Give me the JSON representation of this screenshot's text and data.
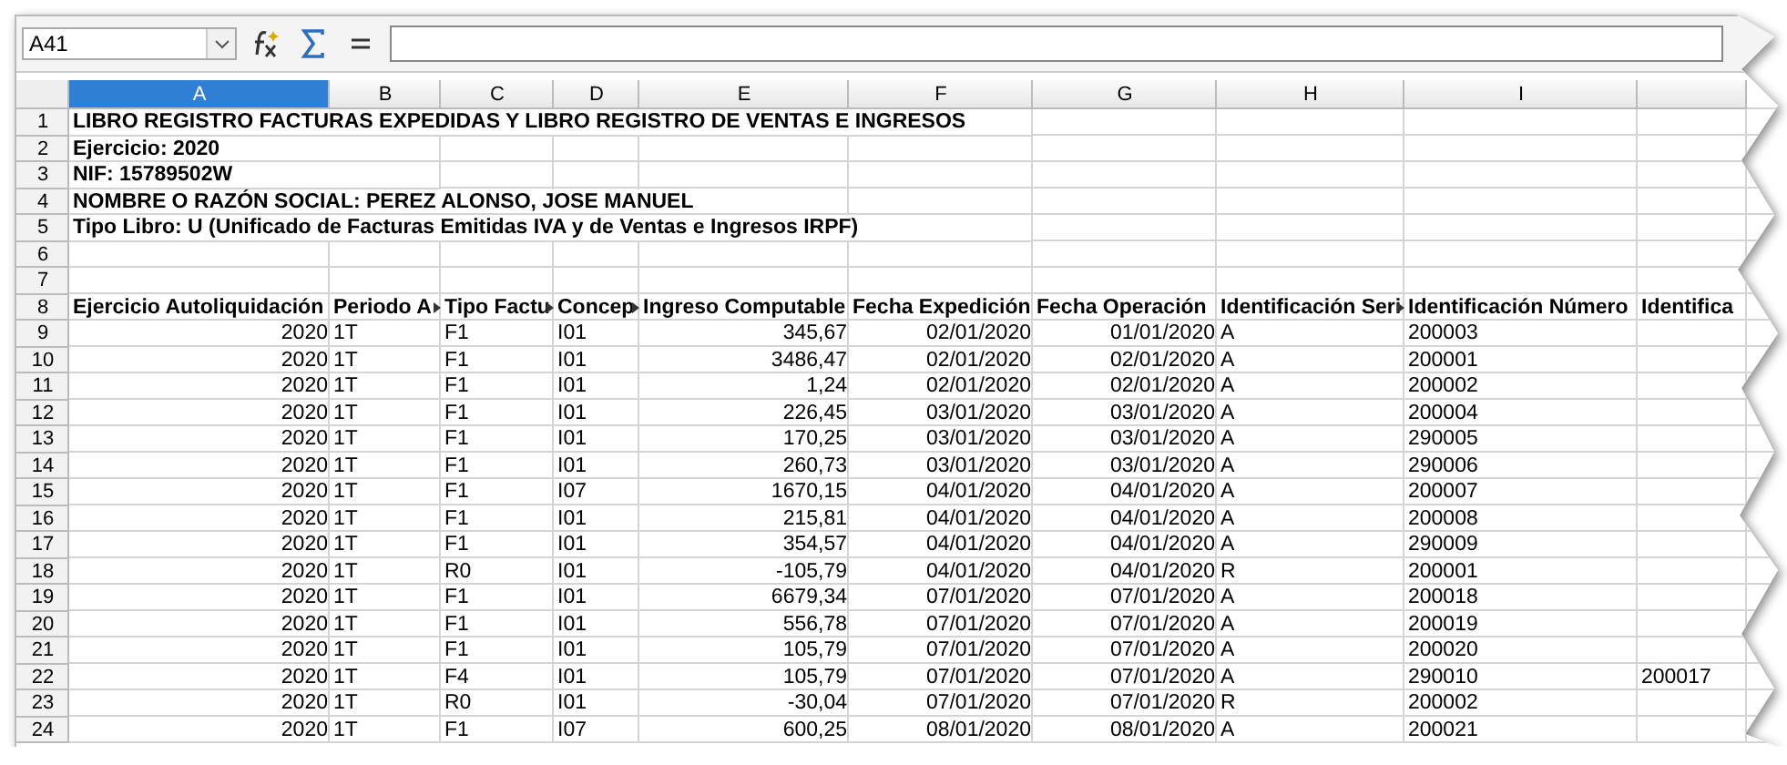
{
  "name_box": {
    "value": "A41"
  },
  "columns": [
    {
      "label": "A",
      "selected": true
    },
    {
      "label": "B",
      "selected": false
    },
    {
      "label": "C",
      "selected": false
    },
    {
      "label": "D",
      "selected": false
    },
    {
      "label": "E",
      "selected": false
    },
    {
      "label": "F",
      "selected": false
    },
    {
      "label": "G",
      "selected": false
    },
    {
      "label": "H",
      "selected": false
    },
    {
      "label": "I",
      "selected": false
    }
  ],
  "rows": [
    {
      "number": "1",
      "kind": "title",
      "text": "LIBRO REGISTRO FACTURAS EXPEDIDAS Y LIBRO REGISTRO DE VENTAS E INGRESOS"
    },
    {
      "number": "2",
      "kind": "title",
      "text": "Ejercicio: 2020"
    },
    {
      "number": "3",
      "kind": "title",
      "text": "NIF: 15789502W"
    },
    {
      "number": "4",
      "kind": "title",
      "text": "NOMBRE O RAZÓN SOCIAL: PEREZ ALONSO, JOSE MANUEL"
    },
    {
      "number": "5",
      "kind": "title",
      "text": "Tipo Libro: U (Unificado de Facturas Emitidas IVA y de Ventas e Ingresos IRPF)"
    },
    {
      "number": "6",
      "kind": "empty"
    },
    {
      "number": "7",
      "kind": "empty"
    },
    {
      "number": "8",
      "kind": "header",
      "cells": [
        {
          "text": "Ejercicio Autoliquidación",
          "truncated": false
        },
        {
          "text": "Periodo A",
          "truncated": true
        },
        {
          "text": "Tipo Factu",
          "truncated": true
        },
        {
          "text": "Concep",
          "truncated": true
        },
        {
          "text": "Ingreso Computable",
          "truncated": false
        },
        {
          "text": "Fecha Expedición",
          "truncated": false
        },
        {
          "text": "Fecha Operación",
          "truncated": false
        },
        {
          "text": "Identificación Seri",
          "truncated": true
        },
        {
          "text": "Identificación Número",
          "truncated": false
        },
        {
          "text": "Identifica",
          "truncated": false
        }
      ]
    },
    {
      "number": "9",
      "kind": "data",
      "cells": [
        "2020",
        "1T",
        "F1",
        "I01",
        "345,67",
        "02/01/2020",
        "01/01/2020",
        "A",
        "200003"
      ]
    },
    {
      "number": "10",
      "kind": "data",
      "cells": [
        "2020",
        "1T",
        "F1",
        "I01",
        "3486,47",
        "02/01/2020",
        "02/01/2020",
        "A",
        "200001"
      ]
    },
    {
      "number": "11",
      "kind": "data",
      "cells": [
        "2020",
        "1T",
        "F1",
        "I01",
        "1,24",
        "02/01/2020",
        "02/01/2020",
        "A",
        "200002"
      ]
    },
    {
      "number": "12",
      "kind": "data",
      "cells": [
        "2020",
        "1T",
        "F1",
        "I01",
        "226,45",
        "03/01/2020",
        "03/01/2020",
        "A",
        "200004"
      ]
    },
    {
      "number": "13",
      "kind": "data",
      "cells": [
        "2020",
        "1T",
        "F1",
        "I01",
        "170,25",
        "03/01/2020",
        "03/01/2020",
        "A",
        "290005"
      ]
    },
    {
      "number": "14",
      "kind": "data",
      "cells": [
        "2020",
        "1T",
        "F1",
        "I01",
        "260,73",
        "03/01/2020",
        "03/01/2020",
        "A",
        "290006"
      ]
    },
    {
      "number": "15",
      "kind": "data",
      "cells": [
        "2020",
        "1T",
        "F1",
        "I07",
        "1670,15",
        "04/01/2020",
        "04/01/2020",
        "A",
        "200007"
      ]
    },
    {
      "number": "16",
      "kind": "data",
      "cells": [
        "2020",
        "1T",
        "F1",
        "I01",
        "215,81",
        "04/01/2020",
        "04/01/2020",
        "A",
        "200008"
      ]
    },
    {
      "number": "17",
      "kind": "data",
      "cells": [
        "2020",
        "1T",
        "F1",
        "I01",
        "354,57",
        "04/01/2020",
        "04/01/2020",
        "A",
        "290009"
      ]
    },
    {
      "number": "18",
      "kind": "data",
      "cells": [
        "2020",
        "1T",
        "R0",
        "I01",
        "-105,79",
        "04/01/2020",
        "04/01/2020",
        "R",
        "200001"
      ]
    },
    {
      "number": "19",
      "kind": "data",
      "cells": [
        "2020",
        "1T",
        "F1",
        "I01",
        "6679,34",
        "07/01/2020",
        "07/01/2020",
        "A",
        "200018"
      ]
    },
    {
      "number": "20",
      "kind": "data",
      "cells": [
        "2020",
        "1T",
        "F1",
        "I01",
        "556,78",
        "07/01/2020",
        "07/01/2020",
        "A",
        "200019"
      ]
    },
    {
      "number": "21",
      "kind": "data",
      "cells": [
        "2020",
        "1T",
        "F1",
        "I01",
        "105,79",
        "07/01/2020",
        "07/01/2020",
        "A",
        "200020"
      ]
    },
    {
      "number": "22",
      "kind": "data",
      "cells": [
        "2020",
        "1T",
        "F4",
        "I01",
        "105,79",
        "07/01/2020",
        "07/01/2020",
        "A",
        "290010",
        "200017"
      ]
    },
    {
      "number": "23",
      "kind": "data",
      "cells": [
        "2020",
        "1T",
        "R0",
        "I01",
        "-30,04",
        "07/01/2020",
        "07/01/2020",
        "R",
        "200002"
      ]
    },
    {
      "number": "24",
      "kind": "data",
      "cells": [
        "2020",
        "1T",
        "F1",
        "I07",
        "600,25",
        "08/01/2020",
        "08/01/2020",
        "A",
        "200021"
      ]
    }
  ]
}
